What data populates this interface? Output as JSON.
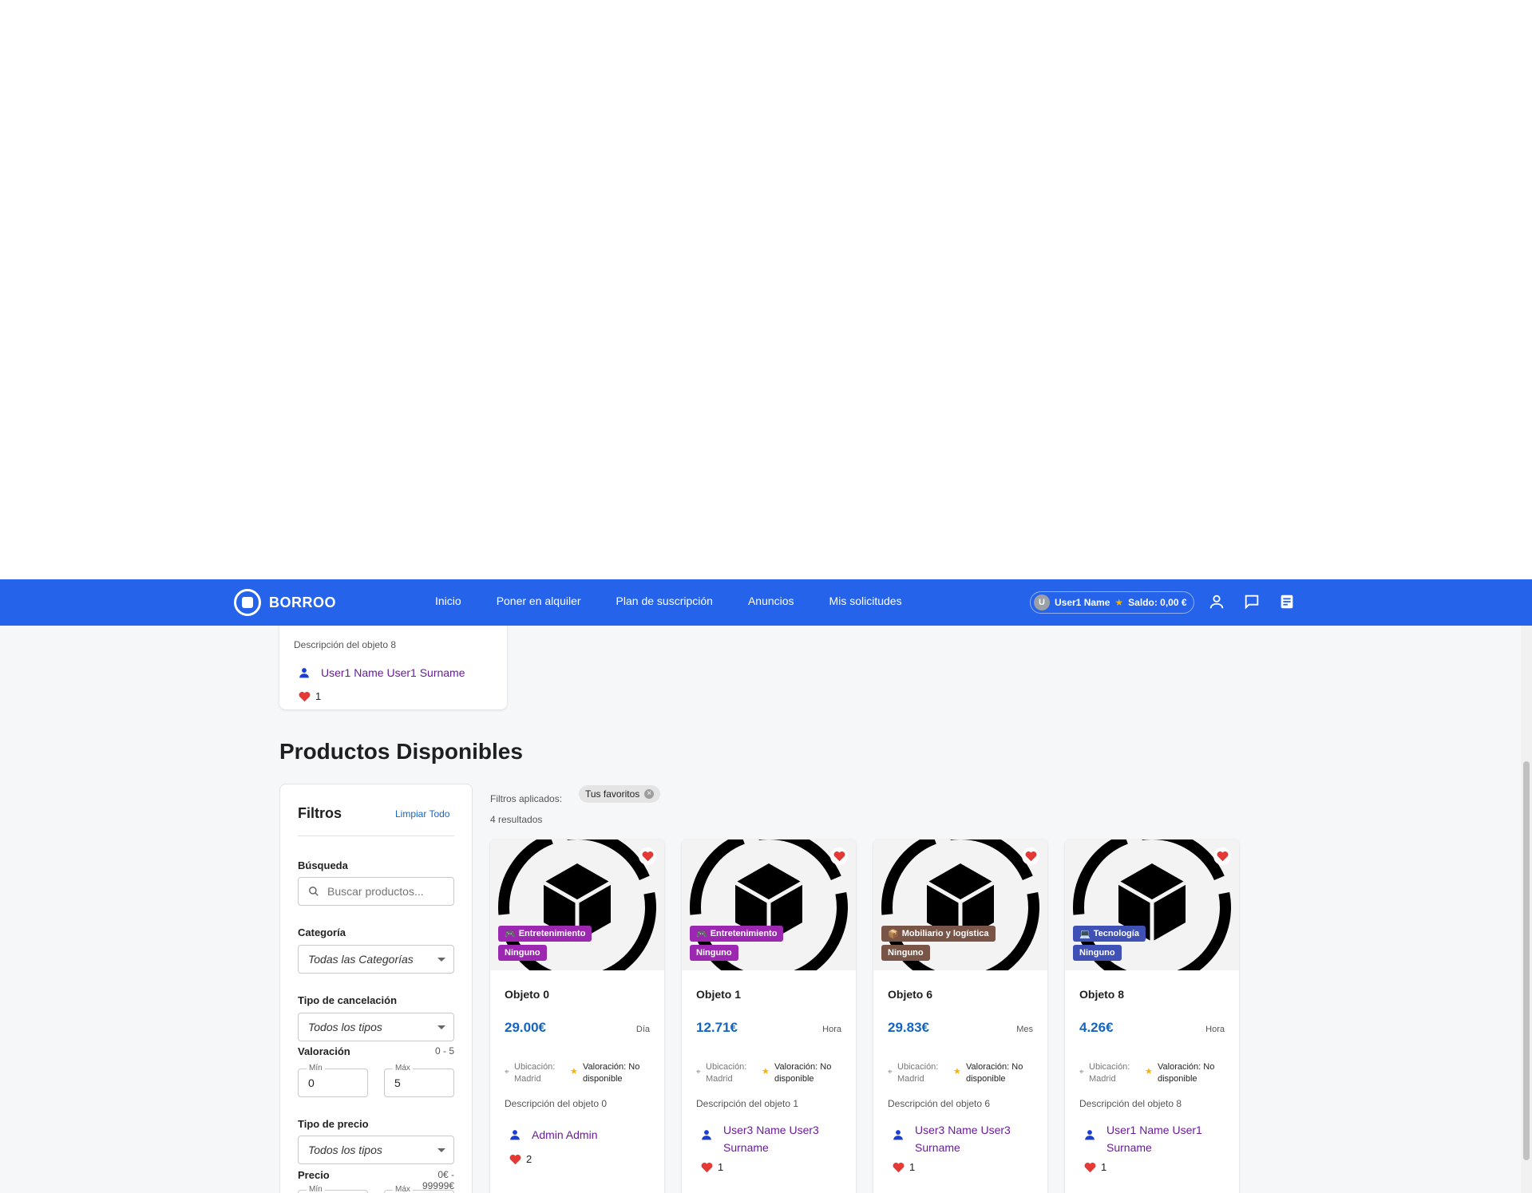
{
  "brand": {
    "name": "BORROO"
  },
  "nav": {
    "links": [
      "Inicio",
      "Poner en alquiler",
      "Plan de suscripción",
      "Anuncios",
      "Mis solicitudes"
    ],
    "user": {
      "initial": "U",
      "name": "User1 Name",
      "balance": "Saldo: 0,00 €"
    }
  },
  "previous_card": {
    "description": "Descripción del objeto 8",
    "owner": "User1 Name User1 Surname",
    "likes": "1"
  },
  "section_title": "Productos Disponibles",
  "filters": {
    "title": "Filtros",
    "clear_label": "Limpiar Todo",
    "search_label": "Búsqueda",
    "search_placeholder": "Buscar productos...",
    "category_label": "Categoría",
    "category_value": "Todas las Categorías",
    "cancel_label": "Tipo de cancelación",
    "cancel_value": "Todos los tipos",
    "rating_label": "Valoración",
    "rating_range": "0 - 5",
    "rating_min_legend": "Mín",
    "rating_min": "0",
    "rating_max_legend": "Máx",
    "rating_max": "5",
    "price_type_label": "Tipo de precio",
    "price_type_value": "Todos los tipos",
    "price_label": "Precio",
    "price_range": "0€ - 99999€",
    "price_min_legend": "Mín",
    "price_max_legend": "Máx"
  },
  "applied": {
    "label": "Filtros aplicados:",
    "chip": "Tus favoritos",
    "results": "4 resultados"
  },
  "colors": {
    "primary": "#2563eb",
    "price": "#1565c0",
    "owner": "#6a1b9a",
    "tag_entretenimiento": "#9c27b0",
    "tag_mobiliario": "#795548",
    "tag_tecnologia": "#3f51b5",
    "heart": "#e53935"
  },
  "products": [
    {
      "category": "Entretenimiento",
      "category_icon": "gamepad-icon",
      "cancel": "Ninguno",
      "title": "Objeto 0",
      "price": "29.00€",
      "unit": "Día",
      "location_label": "Ubicación:",
      "location": "Madrid",
      "rating_label": "Valoración: No",
      "rating_value": "disponible",
      "description": "Descripción del objeto 0",
      "owner_line1": "Admin Admin",
      "owner_line2": "",
      "likes": "2"
    },
    {
      "category": "Entretenimiento",
      "category_icon": "gamepad-icon",
      "cancel": "Ninguno",
      "title": "Objeto 1",
      "price": "12.71€",
      "unit": "Hora",
      "location_label": "Ubicación:",
      "location": "Madrid",
      "rating_label": "Valoración: No",
      "rating_value": "disponible",
      "description": "Descripción del objeto 1",
      "owner_line1": "User3 Name User3",
      "owner_line2": "Surname",
      "likes": "1"
    },
    {
      "category": "Mobiliario y logística",
      "category_icon": "package-icon",
      "cancel": "Ninguno",
      "title": "Objeto 6",
      "price": "29.83€",
      "unit": "Mes",
      "location_label": "Ubicación:",
      "location": "Madrid",
      "rating_label": "Valoración: No",
      "rating_value": "disponible",
      "description": "Descripción del objeto 6",
      "owner_line1": "User3 Name User3",
      "owner_line2": "Surname",
      "likes": "1"
    },
    {
      "category": "Tecnología",
      "category_icon": "laptop-icon",
      "cancel": "Ninguno",
      "title": "Objeto 8",
      "price": "4.26€",
      "unit": "Hora",
      "location_label": "Ubicación:",
      "location": "Madrid",
      "rating_label": "Valoración: No",
      "rating_value": "disponible",
      "description": "Descripción del objeto 8",
      "owner_line1": "User1 Name User1",
      "owner_line2": "Surname",
      "likes": "1"
    }
  ]
}
